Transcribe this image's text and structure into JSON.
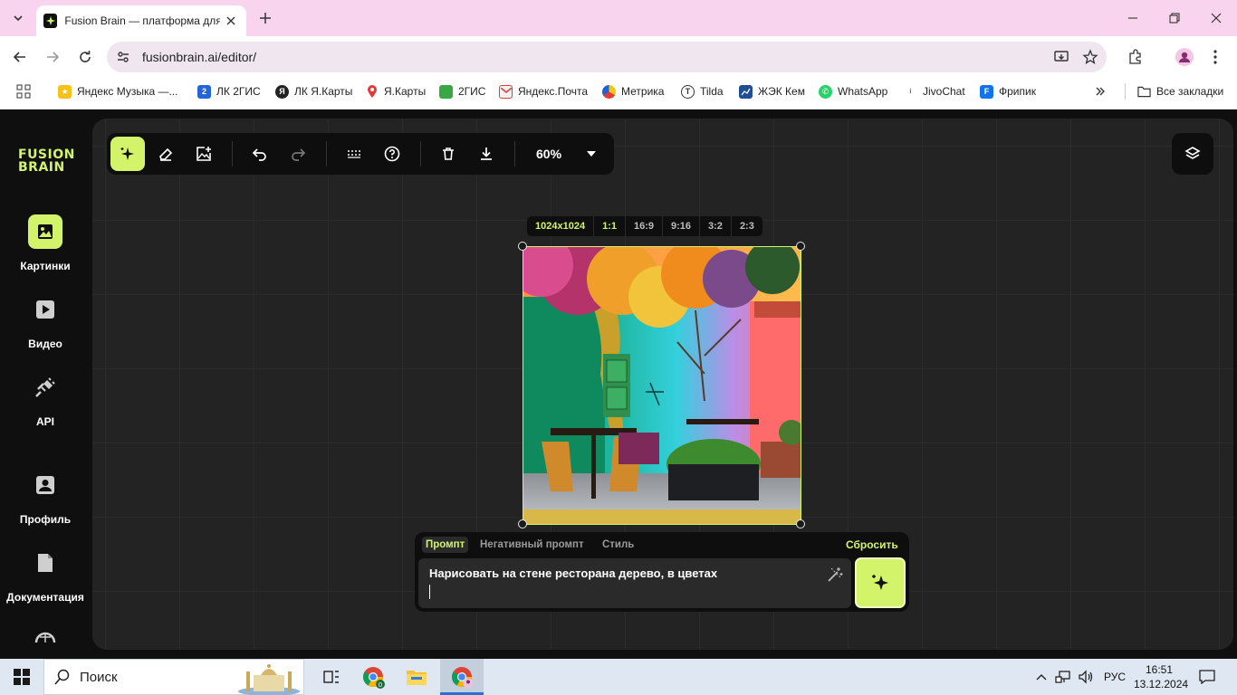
{
  "browser": {
    "tab_title": "Fusion Brain — платформа для",
    "url": "fusionbrain.ai/editor/",
    "bookmarks": [
      {
        "label": "Яндекс Музыка —...",
        "icon": "yandex-music-icon"
      },
      {
        "label": "ЛК 2ГИС",
        "icon": "2gis-icon"
      },
      {
        "label": "ЛК Я.Карты",
        "icon": "yandex-icon"
      },
      {
        "label": "Я.Карты",
        "icon": "map-pin-icon"
      },
      {
        "label": "2ГИС",
        "icon": "2gis-map-icon"
      },
      {
        "label": "Яндекс.Почта",
        "icon": "mail-icon"
      },
      {
        "label": "Метрика",
        "icon": "metrika-icon"
      },
      {
        "label": "Tilda",
        "icon": "tilda-icon"
      },
      {
        "label": "ЖЭК Кем",
        "icon": "chart-icon"
      },
      {
        "label": "WhatsApp",
        "icon": "whatsapp-icon"
      },
      {
        "label": "JivoChat",
        "icon": "jivochat-icon"
      },
      {
        "label": "Фрипик",
        "icon": "freepik-icon"
      }
    ],
    "all_bookmarks": "Все закладки"
  },
  "app": {
    "logo_line1": "FUSION",
    "logo_line2": "BRAIN",
    "nav": [
      {
        "label": "Картинки",
        "icon": "image-icon",
        "active": true
      },
      {
        "label": "Видео",
        "icon": "play-icon",
        "active": false
      },
      {
        "label": "API",
        "icon": "plug-icon",
        "active": false
      },
      {
        "label": "Профиль",
        "icon": "profile-icon",
        "active": false
      },
      {
        "label": "Документация",
        "icon": "document-icon",
        "active": false
      }
    ],
    "zoom": "60%",
    "resolution": "1024x1024",
    "ratios": [
      "1:1",
      "16:9",
      "9:16",
      "3:2",
      "2:3"
    ],
    "active_ratio": "1:1",
    "prompt_tabs": [
      "Промпт",
      "Негативный промпт",
      "Стиль"
    ],
    "active_prompt_tab": "Промпт",
    "reset_label": "Сбросить",
    "prompt_text": "Нарисовать на стене ресторана дерево, в цветах",
    "accent_color": "#d3f36b"
  },
  "taskbar": {
    "search_placeholder": "Поиск",
    "language": "РУС",
    "time": "16:51",
    "date": "13.12.2024"
  }
}
